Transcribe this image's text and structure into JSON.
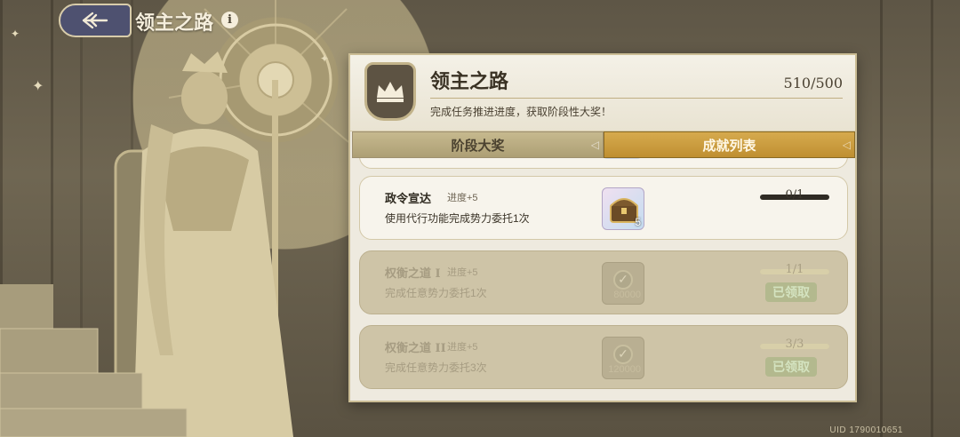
{
  "header": {
    "title": "领主之路",
    "info_symbol": "i"
  },
  "panel": {
    "title": "领主之路",
    "score": "510/500",
    "subtitle": "完成任务推进进度，获取阶段性大奖！",
    "crest_icon": "crown-icon"
  },
  "tabs": [
    {
      "label": "阶段大奖",
      "active": false
    },
    {
      "label": "成就列表",
      "active": true
    }
  ],
  "tasks": [
    {
      "name": "政令宣达",
      "progress_text": "进度+5",
      "description": "使用代行功能完成势力委托1次",
      "reward_icon": "treasure-chest-icon",
      "reward_qty": "5",
      "counter": "0/1",
      "fraction": 0,
      "claimed": false
    },
    {
      "name": "权衡之道 I",
      "progress_text": "进度+5",
      "description": "完成任意势力委托1次",
      "reward_icon": "check-coin-icon",
      "reward_qty": "80000",
      "counter": "1/1",
      "fraction": 1,
      "claimed": true,
      "claimed_label": "已领取"
    },
    {
      "name": "权衡之道 II",
      "progress_text": "进度+5",
      "description": "完成任意势力委托3次",
      "reward_icon": "check-coin-icon",
      "reward_qty": "120000",
      "counter": "3/3",
      "fraction": 1,
      "claimed": true,
      "claimed_label": "已领取"
    }
  ],
  "footer": {
    "uid": "UID 1790010651"
  },
  "colors": {
    "tab_active": "#c8993a",
    "tab_inactive": "#b8ab81",
    "panel_bg": "#eeeadf",
    "back_button": "#4e5170"
  }
}
